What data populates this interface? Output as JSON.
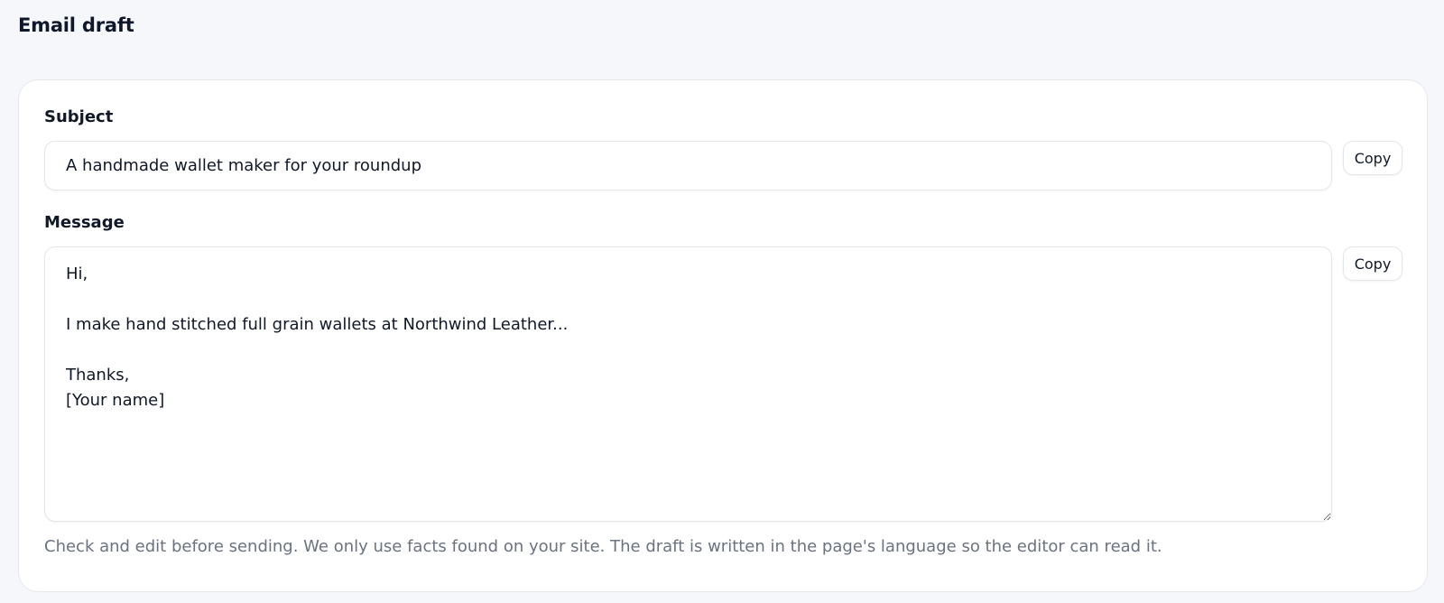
{
  "page": {
    "title": "Email draft"
  },
  "subject": {
    "label": "Subject",
    "value": "A handmade wallet maker for your roundup",
    "copy_label": "Copy"
  },
  "message": {
    "label": "Message",
    "value": "Hi,\n\nI make hand stitched full grain wallets at Northwind Leather...\n\nThanks,\n[Your name]",
    "copy_label": "Copy"
  },
  "help_text": "Check and edit before sending. We only use facts found on your site. The draft is written in the page's language so the editor can read it."
}
